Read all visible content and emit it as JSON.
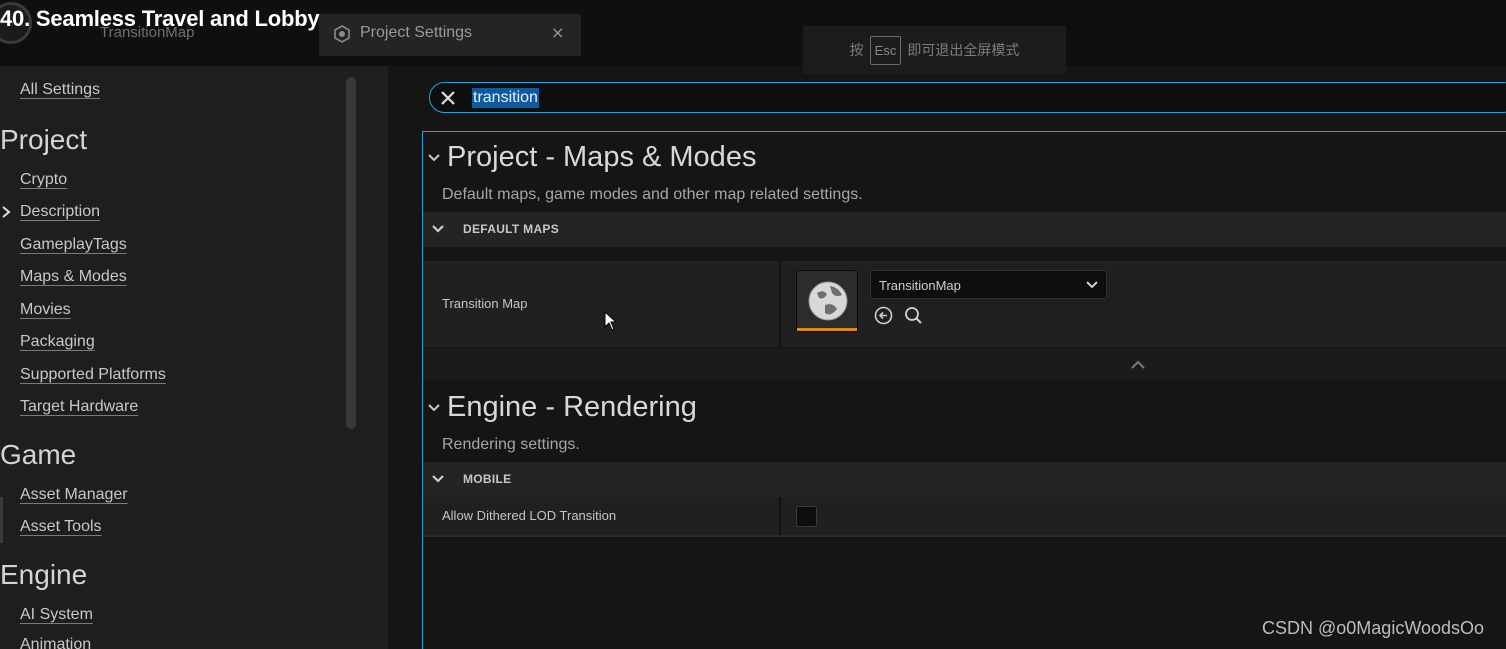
{
  "overlay_title": "40. Seamless Travel and Lobby",
  "tabs": {
    "map_tab": {
      "label": "TransitionMap"
    },
    "settings_tab": {
      "label": "Project Settings",
      "icon": "gear-cube-icon",
      "close": "×"
    }
  },
  "fullscreen_hint": {
    "prefix": "按",
    "key": "Esc",
    "suffix": "即可退出全屏模式"
  },
  "sidebar": {
    "all_settings": "All Settings",
    "sections": [
      {
        "heading": "Project",
        "items": [
          "Crypto",
          "Description",
          "GameplayTags",
          "Maps & Modes",
          "Movies",
          "Packaging",
          "Supported Platforms",
          "Target Hardware"
        ]
      },
      {
        "heading": "Game",
        "items": [
          "Asset Manager",
          "Asset Tools"
        ]
      },
      {
        "heading": "Engine",
        "items": [
          "AI System",
          "Animation"
        ]
      }
    ]
  },
  "search": {
    "value": "transition"
  },
  "sections": [
    {
      "title": "Project - Maps & Modes",
      "description": "Default maps, game modes and other map related settings.",
      "category": "DEFAULT MAPS",
      "property": {
        "name": "Transition Map",
        "value": "TransitionMap",
        "thumbnail": "world-globe-icon"
      }
    },
    {
      "title": "Engine - Rendering",
      "description": "Rendering settings.",
      "category": "MOBILE",
      "property": {
        "name": "Allow Dithered LOD Transition",
        "checked": false
      }
    }
  ],
  "watermark": "CSDN @o0MagicWoodsOo",
  "colors": {
    "accent": "#2aa0cf",
    "selection": "#0f5a9e",
    "asset_underline": "#e08a1e",
    "background": "#151515"
  }
}
